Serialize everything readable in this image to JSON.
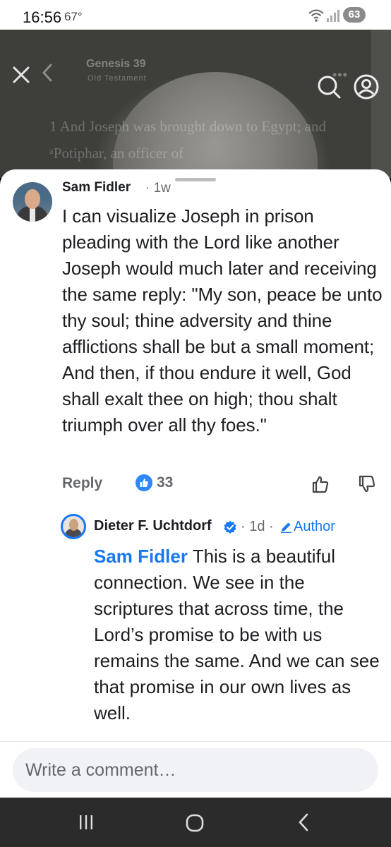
{
  "status_bar": {
    "time": "16:56",
    "temperature": "67°",
    "battery": "63"
  },
  "background": {
    "book_title": "Genesis 39",
    "book_subtitle": "Old Testament",
    "verse_text": "1 And Joseph was brought down to Egypt; and ᵃPotiphar, an officer of"
  },
  "icons": {
    "close": "close-icon",
    "back": "chevron-left-icon",
    "search": "search-icon",
    "profile": "profile-icon",
    "more": "more-icon"
  },
  "comments": [
    {
      "author": "Sam Fidler",
      "time": "· 1w",
      "body": "I can visualize Joseph in prison pleading with the Lord like another Joseph would much later and receiving the same reply: \"My son, peace be unto thy soul; thine adversity and thine afflictions shall be but a small moment; And then, if thou endure it well, God shall exalt thee on high; thou shalt triumph over all thy foes.\"",
      "reply_label": "Reply",
      "like_count": "33"
    }
  ],
  "reply": {
    "author": "Dieter F. Uchtdorf",
    "time": "· 1d ·",
    "badge": "Author",
    "mention": "Sam Fidler",
    "body": " This is a beautiful connection. We see in the scriptures that across time, the Lord’s promise to be with us remains the same. And we can see that promise in our own lives as well."
  },
  "composer": {
    "placeholder": "Write a comment…"
  },
  "colors": {
    "accent": "#1877f2",
    "muted": "#65676b",
    "text": "#1c1e21"
  }
}
